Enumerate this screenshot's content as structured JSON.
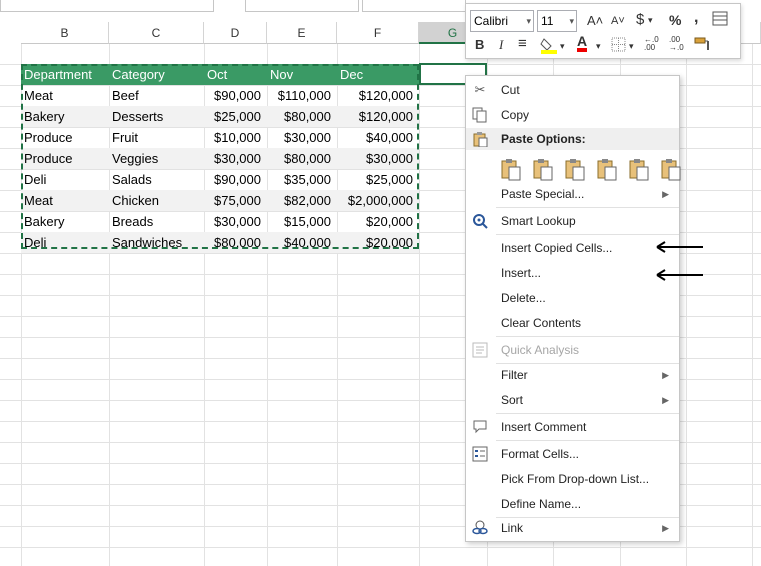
{
  "columns": [
    "B",
    "C",
    "D",
    "E",
    "F",
    "G"
  ],
  "table": {
    "headers": [
      "Department",
      "Category",
      "Oct",
      "Nov",
      "Dec"
    ],
    "rows": [
      [
        "Meat",
        "Beef",
        "$90,000",
        "$110,000",
        "$120,000"
      ],
      [
        "Bakery",
        "Desserts",
        "$25,000",
        "$80,000",
        "$120,000"
      ],
      [
        "Produce",
        "Fruit",
        "$10,000",
        "$30,000",
        "$40,000"
      ],
      [
        "Produce",
        "Veggies",
        "$30,000",
        "$80,000",
        "$30,000"
      ],
      [
        "Deli",
        "Salads",
        "$90,000",
        "$35,000",
        "$25,000"
      ],
      [
        "Meat",
        "Chicken",
        "$75,000",
        "$82,000",
        "$2,000,000"
      ],
      [
        "Bakery",
        "Breads",
        "$30,000",
        "$15,000",
        "$20,000"
      ],
      [
        "Deli",
        "Sandwiches",
        "$80,000",
        "$40,000",
        "$20,000"
      ]
    ]
  },
  "mini_toolbar": {
    "font": "Calibri",
    "size": "11",
    "grow": "A˄",
    "shrink": "A˅",
    "currency": "$",
    "percent": "%",
    "comma": ",",
    "bold": "B",
    "italic": "I",
    "align": "≡",
    "fill": "A",
    "font_color": "A",
    "inc_decimal": "←.0\n.00",
    "dec_decimal": ".00\n→.0"
  },
  "menu": {
    "cut": "Cut",
    "copy": "Copy",
    "paste_options": "Paste Options:",
    "paste_special": "Paste Special...",
    "smart_lookup": "Smart Lookup",
    "insert_copied": "Insert Copied Cells...",
    "insert": "Insert...",
    "delete": "Delete...",
    "clear": "Clear Contents",
    "quick_analysis": "Quick Analysis",
    "filter": "Filter",
    "sort": "Sort",
    "insert_comment": "Insert Comment",
    "format_cells": "Format Cells...",
    "pick_list": "Pick From Drop-down List...",
    "define_name": "Define Name...",
    "link": "Link"
  },
  "colors": {
    "header_fill": "#3a9a65",
    "band_fill": "#f2f2f2",
    "marquee": "#217346"
  }
}
